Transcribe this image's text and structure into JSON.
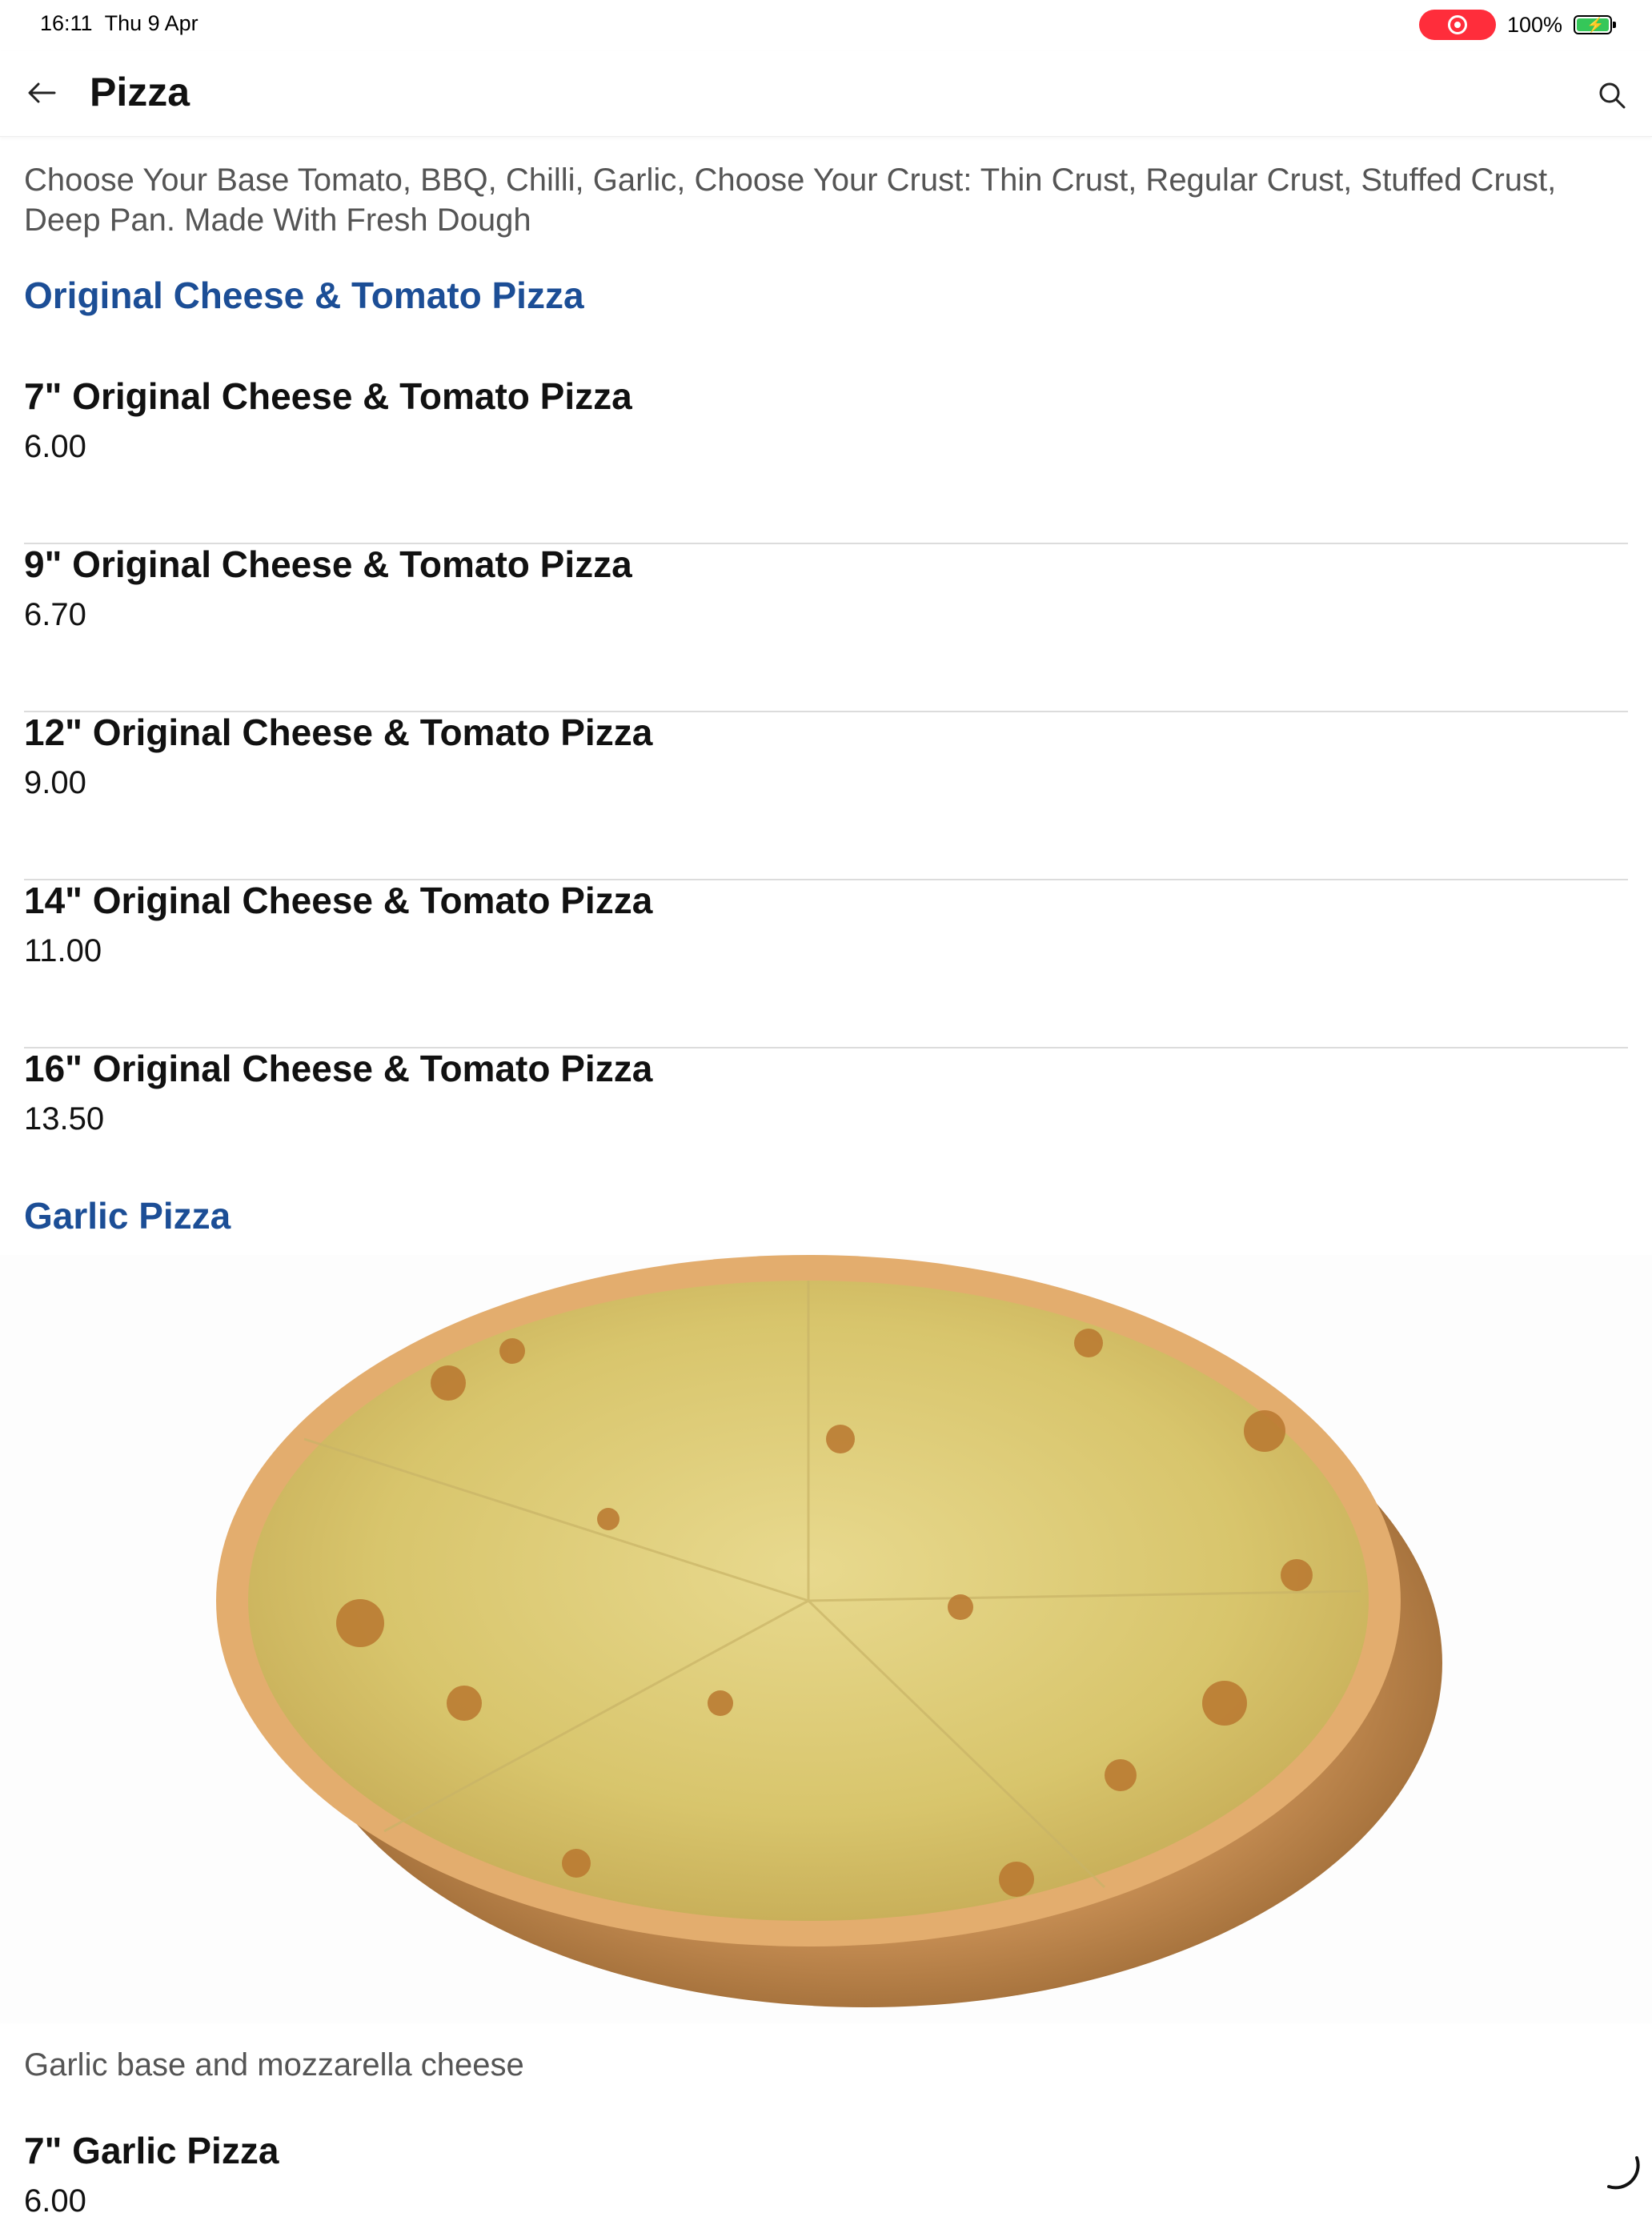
{
  "status_bar": {
    "time": "16:11",
    "date": "Thu 9 Apr",
    "battery_percent": "100%",
    "recording_color": "#ff2d3b",
    "battery_color": "#35c759"
  },
  "nav": {
    "back_icon": "arrow-left-icon",
    "title": "Pizza",
    "search_icon": "search-icon"
  },
  "category_description": "Choose Your Base Tomato, BBQ, Chilli, Garlic, Choose Your Crust: Thin Crust, Regular Crust, Stuffed Crust, Deep Pan. Made With Fresh Dough",
  "sections": [
    {
      "title": "Original Cheese & Tomato Pizza",
      "items": [
        {
          "name": "7\" Original Cheese & Tomato Pizza",
          "price": "6.00"
        },
        {
          "name": "9\" Original Cheese & Tomato Pizza",
          "price": "6.70"
        },
        {
          "name": "12\" Original Cheese & Tomato Pizza",
          "price": "9.00"
        },
        {
          "name": "14\" Original Cheese & Tomato Pizza",
          "price": "11.00"
        },
        {
          "name": "16\" Original Cheese & Tomato Pizza",
          "price": "13.50"
        }
      ]
    },
    {
      "title": "Garlic Pizza",
      "image_description": "Garlic base and mozzarella cheese",
      "items": [
        {
          "name": "7\" Garlic Pizza",
          "price": "6.00"
        }
      ]
    }
  ],
  "colors": {
    "section_title": "#1c4e96",
    "description_text": "#555555",
    "divider": "#dcdcdc"
  }
}
